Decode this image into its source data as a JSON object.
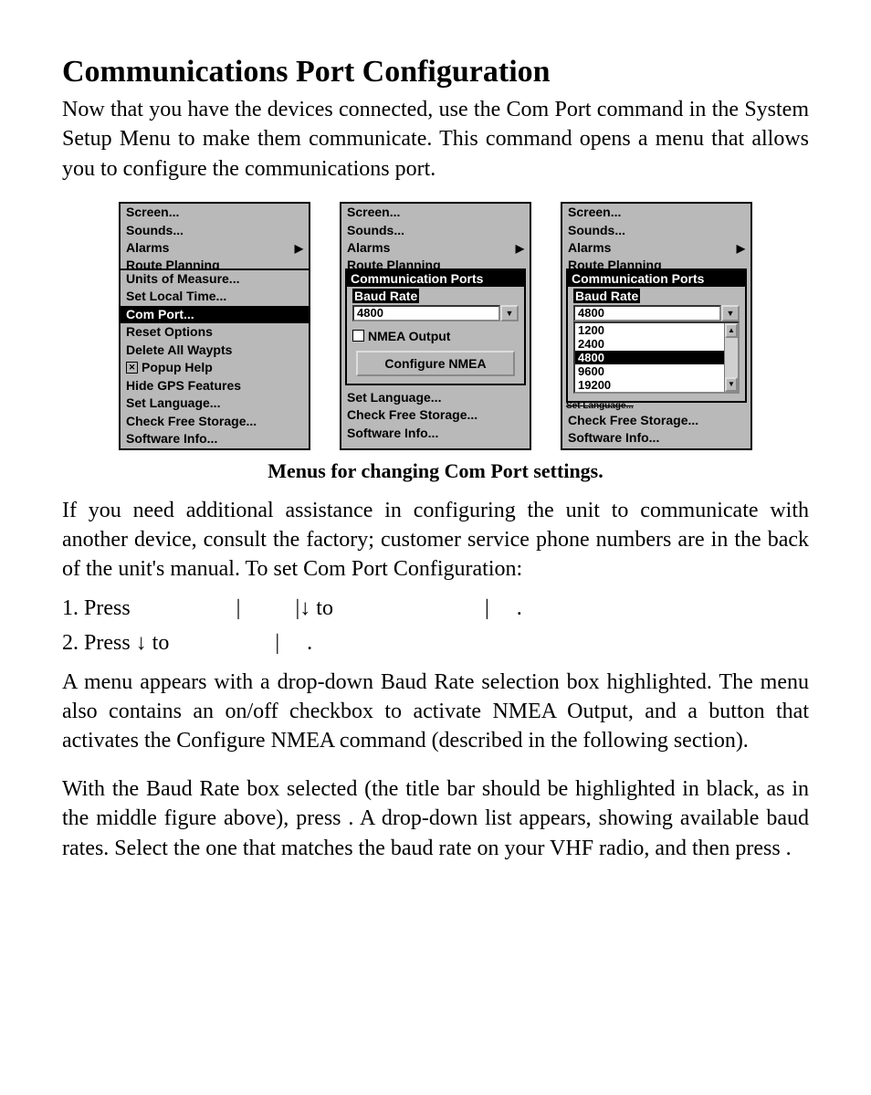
{
  "title": "Communications Port Configuration",
  "intro": "Now that you have the devices connected, use the Com Port command in the System Setup Menu to make them communicate. This command opens a menu that allows you to configure the communications port.",
  "panel1": {
    "items": [
      {
        "label": "Screen...",
        "selected": false
      },
      {
        "label": "Sounds...",
        "selected": false
      },
      {
        "label": "Alarms",
        "selected": false,
        "submenu": true
      }
    ],
    "clipped": "Route Planning",
    "items2": [
      {
        "label": "Units of Measure...",
        "selected": false
      },
      {
        "label": "Set Local Time...",
        "selected": false
      },
      {
        "label": "Com Port...",
        "selected": true
      },
      {
        "label": "Reset Options",
        "selected": false
      },
      {
        "label": "Delete All Waypts",
        "selected": false
      },
      {
        "label": "Popup Help",
        "selected": false,
        "checked": true
      },
      {
        "label": "Hide GPS Features",
        "selected": false
      },
      {
        "label": "Set Language...",
        "selected": false
      },
      {
        "label": "Check Free Storage...",
        "selected": false
      },
      {
        "label": "Software Info...",
        "selected": false
      }
    ]
  },
  "panel2": {
    "items": [
      {
        "label": "Screen...",
        "selected": false
      },
      {
        "label": "Sounds...",
        "selected": false
      },
      {
        "label": "Alarms",
        "selected": false,
        "submenu": true
      }
    ],
    "clipped": "Route Planning",
    "sub": {
      "title": "Communication Ports",
      "baud_label": "Baud Rate",
      "baud_value": "4800",
      "nmea_label": "NMEA Output",
      "button": "Configure NMEA"
    },
    "tail": [
      {
        "label": "Set Language..."
      },
      {
        "label": "Check Free Storage..."
      },
      {
        "label": "Software Info..."
      }
    ]
  },
  "panel3": {
    "items": [
      {
        "label": "Screen...",
        "selected": false
      },
      {
        "label": "Sounds...",
        "selected": false
      },
      {
        "label": "Alarms",
        "selected": false,
        "submenu": true
      }
    ],
    "clipped": "Route Planning",
    "sub": {
      "title": "Communication Ports",
      "baud_label": "Baud Rate",
      "baud_value": "4800",
      "options": [
        "1200",
        "2400",
        "4800",
        "9600",
        "19200"
      ]
    },
    "hint": "Set Language...",
    "tail": [
      {
        "label": "Check Free Storage..."
      },
      {
        "label": "Software Info..."
      }
    ]
  },
  "caption": "Menus for changing Com Port settings.",
  "para2": "If you need additional assistance in configuring the unit to communicate with another device, consult the factory; customer service phone numbers are in the back of the unit's manual. To set Com Port Configuration:",
  "step1_a": "1. Press ",
  "step1_b": "|",
  "step1_c": "|↓ to ",
  "step1_d": "|",
  "step1_e": ".",
  "step2_a": "2. Press ↓ to ",
  "step2_b": "|",
  "step2_c": ".",
  "para3": "A menu appears with a drop-down Baud Rate selection box highlighted. The menu also contains an on/off checkbox to activate NMEA Output, and a button that activates the Configure NMEA command (described in the following section).",
  "para4": "With the Baud Rate box selected (the title bar should be highlighted in black, as in the middle figure above), press       . A drop-down list appears, showing available baud rates. Select the one that matches the baud rate on your VHF radio, and then press         ."
}
